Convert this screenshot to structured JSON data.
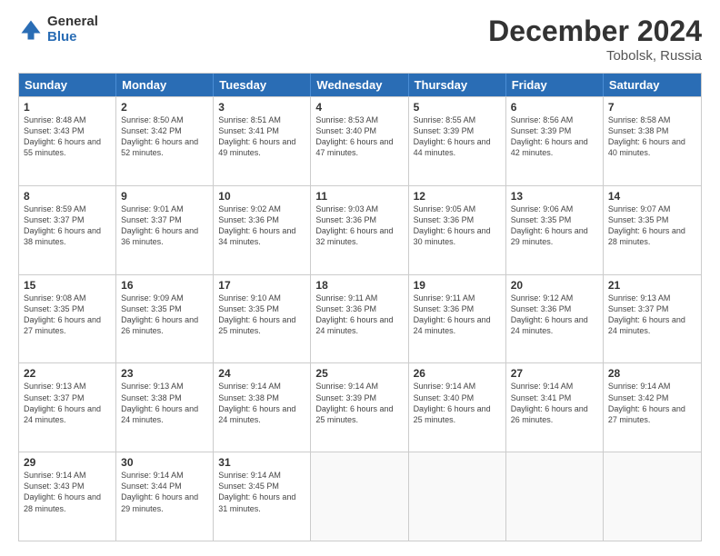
{
  "header": {
    "logo_general": "General",
    "logo_blue": "Blue",
    "title": "December 2024",
    "subtitle": "Tobolsk, Russia"
  },
  "days_of_week": [
    "Sunday",
    "Monday",
    "Tuesday",
    "Wednesday",
    "Thursday",
    "Friday",
    "Saturday"
  ],
  "weeks": [
    [
      {
        "day": "1",
        "sunrise": "8:48 AM",
        "sunset": "3:43 PM",
        "daylight": "6 hours and 55 minutes."
      },
      {
        "day": "2",
        "sunrise": "8:50 AM",
        "sunset": "3:42 PM",
        "daylight": "6 hours and 52 minutes."
      },
      {
        "day": "3",
        "sunrise": "8:51 AM",
        "sunset": "3:41 PM",
        "daylight": "6 hours and 49 minutes."
      },
      {
        "day": "4",
        "sunrise": "8:53 AM",
        "sunset": "3:40 PM",
        "daylight": "6 hours and 47 minutes."
      },
      {
        "day": "5",
        "sunrise": "8:55 AM",
        "sunset": "3:39 PM",
        "daylight": "6 hours and 44 minutes."
      },
      {
        "day": "6",
        "sunrise": "8:56 AM",
        "sunset": "3:39 PM",
        "daylight": "6 hours and 42 minutes."
      },
      {
        "day": "7",
        "sunrise": "8:58 AM",
        "sunset": "3:38 PM",
        "daylight": "6 hours and 40 minutes."
      }
    ],
    [
      {
        "day": "8",
        "sunrise": "8:59 AM",
        "sunset": "3:37 PM",
        "daylight": "6 hours and 38 minutes."
      },
      {
        "day": "9",
        "sunrise": "9:01 AM",
        "sunset": "3:37 PM",
        "daylight": "6 hours and 36 minutes."
      },
      {
        "day": "10",
        "sunrise": "9:02 AM",
        "sunset": "3:36 PM",
        "daylight": "6 hours and 34 minutes."
      },
      {
        "day": "11",
        "sunrise": "9:03 AM",
        "sunset": "3:36 PM",
        "daylight": "6 hours and 32 minutes."
      },
      {
        "day": "12",
        "sunrise": "9:05 AM",
        "sunset": "3:36 PM",
        "daylight": "6 hours and 30 minutes."
      },
      {
        "day": "13",
        "sunrise": "9:06 AM",
        "sunset": "3:35 PM",
        "daylight": "6 hours and 29 minutes."
      },
      {
        "day": "14",
        "sunrise": "9:07 AM",
        "sunset": "3:35 PM",
        "daylight": "6 hours and 28 minutes."
      }
    ],
    [
      {
        "day": "15",
        "sunrise": "9:08 AM",
        "sunset": "3:35 PM",
        "daylight": "6 hours and 27 minutes."
      },
      {
        "day": "16",
        "sunrise": "9:09 AM",
        "sunset": "3:35 PM",
        "daylight": "6 hours and 26 minutes."
      },
      {
        "day": "17",
        "sunrise": "9:10 AM",
        "sunset": "3:35 PM",
        "daylight": "6 hours and 25 minutes."
      },
      {
        "day": "18",
        "sunrise": "9:11 AM",
        "sunset": "3:36 PM",
        "daylight": "6 hours and 24 minutes."
      },
      {
        "day": "19",
        "sunrise": "9:11 AM",
        "sunset": "3:36 PM",
        "daylight": "6 hours and 24 minutes."
      },
      {
        "day": "20",
        "sunrise": "9:12 AM",
        "sunset": "3:36 PM",
        "daylight": "6 hours and 24 minutes."
      },
      {
        "day": "21",
        "sunrise": "9:13 AM",
        "sunset": "3:37 PM",
        "daylight": "6 hours and 24 minutes."
      }
    ],
    [
      {
        "day": "22",
        "sunrise": "9:13 AM",
        "sunset": "3:37 PM",
        "daylight": "6 hours and 24 minutes."
      },
      {
        "day": "23",
        "sunrise": "9:13 AM",
        "sunset": "3:38 PM",
        "daylight": "6 hours and 24 minutes."
      },
      {
        "day": "24",
        "sunrise": "9:14 AM",
        "sunset": "3:38 PM",
        "daylight": "6 hours and 24 minutes."
      },
      {
        "day": "25",
        "sunrise": "9:14 AM",
        "sunset": "3:39 PM",
        "daylight": "6 hours and 25 minutes."
      },
      {
        "day": "26",
        "sunrise": "9:14 AM",
        "sunset": "3:40 PM",
        "daylight": "6 hours and 25 minutes."
      },
      {
        "day": "27",
        "sunrise": "9:14 AM",
        "sunset": "3:41 PM",
        "daylight": "6 hours and 26 minutes."
      },
      {
        "day": "28",
        "sunrise": "9:14 AM",
        "sunset": "3:42 PM",
        "daylight": "6 hours and 27 minutes."
      }
    ],
    [
      {
        "day": "29",
        "sunrise": "9:14 AM",
        "sunset": "3:43 PM",
        "daylight": "6 hours and 28 minutes."
      },
      {
        "day": "30",
        "sunrise": "9:14 AM",
        "sunset": "3:44 PM",
        "daylight": "6 hours and 29 minutes."
      },
      {
        "day": "31",
        "sunrise": "9:14 AM",
        "sunset": "3:45 PM",
        "daylight": "6 hours and 31 minutes."
      },
      null,
      null,
      null,
      null
    ]
  ],
  "labels": {
    "sunrise": "Sunrise:",
    "sunset": "Sunset:",
    "daylight": "Daylight:"
  }
}
